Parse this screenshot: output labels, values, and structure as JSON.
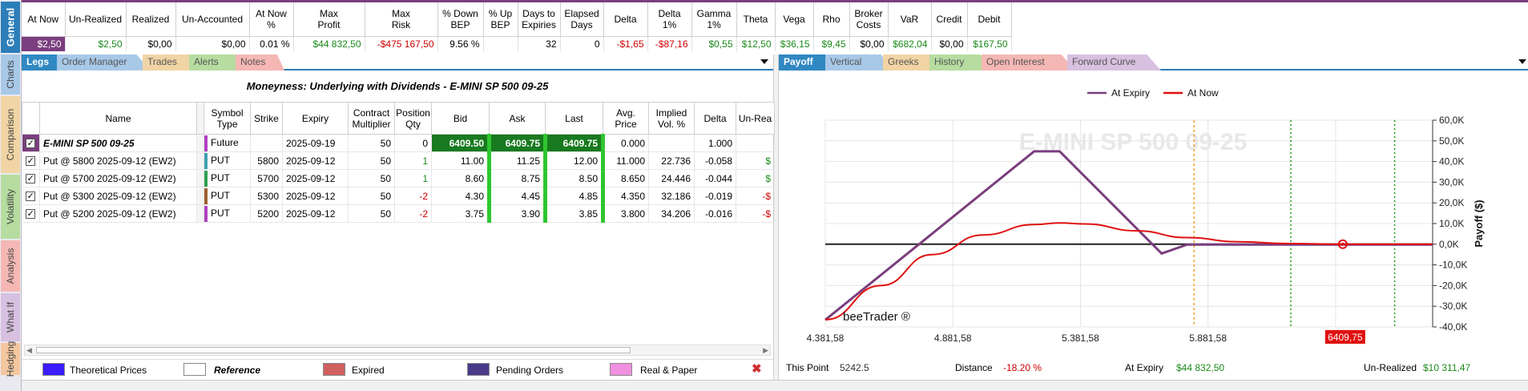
{
  "side_tabs": [
    {
      "label": "General",
      "color": "#2c7eb8",
      "active": true
    },
    {
      "label": "Charts",
      "color": "#a8c8e8"
    },
    {
      "label": "Comparison",
      "color": "#f1d4a4"
    },
    {
      "label": "Volatility",
      "color": "#b6dca0"
    },
    {
      "label": "Analysis",
      "color": "#f5b7b4"
    },
    {
      "label": "What If",
      "color": "#d8c0e0"
    },
    {
      "label": "Hedging",
      "color": "#f5c7a0"
    }
  ],
  "summary": {
    "headers": [
      "At Now",
      "Un-Realized",
      "Realized",
      "Un-Accounted",
      "At Now\n%",
      "Max\nProfit",
      "Max\nRisk",
      "% Down\nBEP",
      "% Up\nBEP",
      "Days to\nExpiries",
      "Elapsed\nDays",
      "Delta",
      "Delta\n1%",
      "Gamma\n1%",
      "Theta",
      "Vega",
      "Rho",
      "Broker\nCosts",
      "VaR",
      "Credit",
      "Debit"
    ],
    "values": [
      "$2,50",
      "$2,50",
      "$0,00",
      "$0,00",
      "0.01 %",
      "$44 832,50",
      "-$475 167,50",
      "9.56 %",
      "",
      "32",
      "0",
      "-$1,65",
      "-$87,16",
      "$0,55",
      "$12,50",
      "$36,15",
      "$9,45",
      "$0,00",
      "$682,04",
      "$0,00",
      "$167,50"
    ]
  },
  "left_tabs": {
    "items": [
      "Legs",
      "Order Manager",
      "Trades",
      "Alerts",
      "Notes"
    ],
    "colors": [
      "#3088c2",
      "#a8c8e8",
      "#f1d4a4",
      "#b6dca0",
      "#f5b7b4"
    ]
  },
  "right_tabs": {
    "items": [
      "Payoff",
      "Vertical",
      "Greeks",
      "History",
      "Open Interest",
      "Forward Curve"
    ],
    "colors": [
      "#3088c2",
      "#a8c8e8",
      "#f1d4a4",
      "#b6dca0",
      "#f5b7b4",
      "#d8c0e0"
    ]
  },
  "legs": {
    "title": "Moneyness: Underlying with Dividends - E-MINI SP 500 09-25",
    "columns": [
      "Name",
      "Symbol\nType",
      "Strike",
      "Expiry",
      "Contract\nMultiplier",
      "Position\nQty",
      "Bid",
      "Ask",
      "Last",
      "Avg.\nPrice",
      "Implied\nVol. %",
      "Delta",
      "Un-Rea"
    ],
    "rows": [
      {
        "name": "E-MINI SP 500 09-25",
        "type": "Future",
        "strike": "",
        "expiry": "2025-09-19",
        "mult": "50",
        "qty": "0",
        "bid": "6409.50",
        "ask": "6409.75",
        "last": "6409.75",
        "avg": "0.000",
        "iv": "",
        "delta": "1.000",
        "unreal": "",
        "sym_color": "#b040c0"
      },
      {
        "name": "Put @ 5800 2025-09-12 (EW2)",
        "type": "PUT",
        "strike": "5800",
        "expiry": "2025-09-12",
        "mult": "50",
        "qty": "1",
        "bid": "11.00",
        "ask": "11.25",
        "last": "12.00",
        "avg": "11.000",
        "iv": "22.736",
        "delta": "-0.058",
        "unreal": "$",
        "sym_color": "#40a0b0"
      },
      {
        "name": "Put @ 5700 2025-09-12 (EW2)",
        "type": "PUT",
        "strike": "5700",
        "expiry": "2025-09-12",
        "mult": "50",
        "qty": "1",
        "bid": "8.60",
        "ask": "8.75",
        "last": "8.50",
        "avg": "8.650",
        "iv": "24.446",
        "delta": "-0.044",
        "unreal": "$",
        "sym_color": "#30a050"
      },
      {
        "name": "Put @ 5300 2025-09-12 (EW2)",
        "type": "PUT",
        "strike": "5300",
        "expiry": "2025-09-12",
        "mult": "50",
        "qty": "-2",
        "bid": "4.30",
        "ask": "4.45",
        "last": "4.85",
        "avg": "4.350",
        "iv": "32.186",
        "delta": "-0.019",
        "unreal": "-$",
        "sym_color": "#a06030"
      },
      {
        "name": "Put @ 5200 2025-09-12 (EW2)",
        "type": "PUT",
        "strike": "5200",
        "expiry": "2025-09-12",
        "mult": "50",
        "qty": "-2",
        "bid": "3.75",
        "ask": "3.90",
        "last": "3.85",
        "avg": "3.800",
        "iv": "34.206",
        "delta": "-0.016",
        "unreal": "-$",
        "sym_color": "#b040c0"
      }
    ]
  },
  "legend": {
    "items": [
      {
        "label": "Theoretical Prices",
        "color": "#3a1cff"
      },
      {
        "label": "Reference",
        "color": "#ffffff"
      },
      {
        "label": "Expired",
        "color": "#d06060"
      },
      {
        "label": "Pending Orders",
        "color": "#4a3a8a"
      },
      {
        "label": "Real & Paper",
        "color": "#f090e0"
      }
    ]
  },
  "chart_data": {
    "type": "line",
    "title": "E-MINI SP 500 09-25",
    "watermark": "beeTrader ®",
    "ylabel": "Payoff ($)",
    "xlim": [
      4381.58,
      6762.0
    ],
    "ylim": [
      -40000,
      60000
    ],
    "x_ticks": [
      "4.381,58",
      "4.881,58",
      "5.381,58",
      "5.881,58",
      "6."
    ],
    "y_ticks": [
      "60,0K",
      "50,0K",
      "40,0K",
      "30,0K",
      "20,0K",
      "10,0K",
      "0,0K",
      "-10,0K",
      "-20,0K",
      "-30,0K",
      "-40,0K"
    ],
    "current_price_label": "6409,75",
    "series": [
      {
        "name": "At Expiry",
        "color": "#7a3e7e",
        "x": [
          4381.58,
          5200,
          5300,
          5700,
          5800,
          6762
        ],
        "y": [
          -36579,
          44921,
          44921,
          -4500,
          -167,
          -167
        ]
      },
      {
        "name": "At Now",
        "color": "#e01010",
        "x": [
          4381.58,
          4600,
          4800,
          5000,
          5200,
          5300,
          5400,
          5600,
          5800,
          6000,
          6200,
          6409.75,
          6762
        ],
        "y": [
          -36500,
          -20000,
          -5000,
          4500,
          9500,
          10300,
          9800,
          6500,
          3200,
          1200,
          300,
          2.5,
          0
        ]
      }
    ]
  },
  "chart_footer": {
    "this_point_label": "This Point",
    "this_point_value": "5242.5",
    "distance_label": "Distance",
    "distance_value": "-18.20 %",
    "at_expiry_label": "At Expiry",
    "at_expiry_value": "$44 832,50",
    "unrealized_label": "Un-Realized",
    "unrealized_value": "$10 311,47"
  }
}
